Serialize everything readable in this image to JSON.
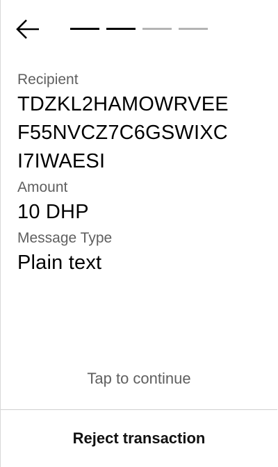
{
  "header": {
    "back_icon": "arrow-left-icon",
    "progress": {
      "total_steps": 4,
      "completed_steps": 2,
      "active_color": "#000000",
      "inactive_color": "#b4b4b4"
    }
  },
  "transaction": {
    "recipient_label": "Recipient",
    "recipient_lines": [
      "TDZKL2HAMOWRVEE",
      "F55NVCZ7C6GSWIXC",
      "I7IWAESI"
    ],
    "amount_label": "Amount",
    "amount_value": "10 DHP",
    "message_type_label": "Message Type",
    "message_type_value": "Plain text"
  },
  "footer": {
    "tap_hint": "Tap to continue",
    "reject_label": "Reject transaction"
  }
}
